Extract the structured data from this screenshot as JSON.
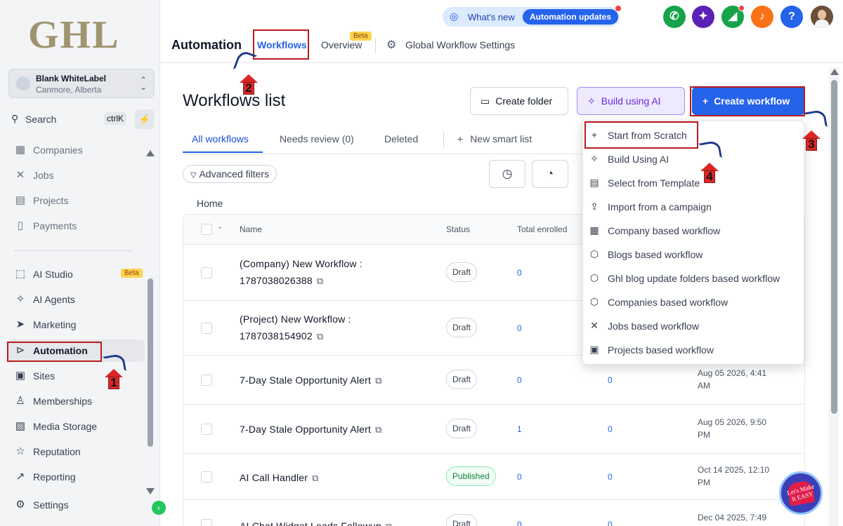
{
  "brand": {
    "logo_text": "GHL"
  },
  "account": {
    "name": "Blank WhiteLabel",
    "location": "Canmore, Alberta"
  },
  "sidebar": {
    "search_label": "Search",
    "search_shortcut": "ctrlK",
    "items": [
      {
        "label": "Companies",
        "icon": "building-icon"
      },
      {
        "label": "Jobs",
        "icon": "tools-icon"
      },
      {
        "label": "Projects",
        "icon": "folder-icon"
      },
      {
        "label": "Payments",
        "icon": "receipt-icon"
      },
      {
        "label": "AI Studio",
        "icon": "ai-studio-icon",
        "badge": "Beta"
      },
      {
        "label": "AI Agents",
        "icon": "sparkle-icon"
      },
      {
        "label": "Marketing",
        "icon": "send-icon"
      },
      {
        "label": "Automation",
        "icon": "automation-icon",
        "active": true
      },
      {
        "label": "Sites",
        "icon": "sites-icon"
      },
      {
        "label": "Memberships",
        "icon": "membership-icon"
      },
      {
        "label": "Media Storage",
        "icon": "image-icon"
      },
      {
        "label": "Reputation",
        "icon": "star-icon"
      },
      {
        "label": "Reporting",
        "icon": "chart-icon"
      },
      {
        "label": "Settings",
        "icon": "gear-icon"
      }
    ]
  },
  "header": {
    "whats_new": "What's new",
    "automation_updates": "Automation updates",
    "page_title": "Automation",
    "tabs": [
      {
        "label": "Workflows",
        "active": true
      },
      {
        "label": "Overview",
        "badge": "Beta"
      },
      {
        "label": "Global Workflow Settings"
      }
    ],
    "icon_colors": {
      "phone": "#16a34a",
      "ai": "#5b21b6",
      "megaphone": "#16a34a",
      "bell": "#f97316",
      "help": "#2563eb"
    }
  },
  "main": {
    "title": "Workflows list",
    "create_folder": "Create folder",
    "build_ai": "Build using AI",
    "create_workflow": "Create workflow",
    "subtabs": [
      "All workflows",
      "Needs review (0)",
      "Deleted"
    ],
    "new_smart_list": "New smart list",
    "advanced_filters": "Advanced filters",
    "breadcrumb": "Home"
  },
  "table": {
    "columns": [
      "Name",
      "Status",
      "Total enrolled"
    ],
    "rows": [
      {
        "name_line1": "(Company) New Workflow :",
        "name_line2": "1787038026388",
        "status": "Draft",
        "enrolled": "0",
        "active": "",
        "date_line1": "",
        "date_line2": ""
      },
      {
        "name_line1": "(Project) New Workflow :",
        "name_line2": "1787038154902",
        "status": "Draft",
        "enrolled": "0",
        "active": "",
        "date_line1": "",
        "date_line2": ""
      },
      {
        "name_line1": "7-Day Stale Opportunity Alert",
        "name_line2": "",
        "status": "Draft",
        "enrolled": "0",
        "active": "0",
        "date_line1": "Aug 05 2026, 4:41",
        "date_line2": "AM"
      },
      {
        "name_line1": "7-Day Stale Opportunity Alert",
        "name_line2": "",
        "status": "Draft",
        "enrolled": "1",
        "active": "0",
        "date_line1": "Aug 05 2026, 9:50",
        "date_line2": "PM"
      },
      {
        "name_line1": "AI Call Handler",
        "name_line2": "",
        "status": "Published",
        "enrolled": "0",
        "active": "0",
        "date_line1": "Oct 14 2025, 12:10",
        "date_line2": "PM"
      },
      {
        "name_line1": "AI Chat Widget Leads Followup",
        "name_line2": "",
        "status": "Draft",
        "enrolled": "0",
        "active": "0",
        "date_line1": "Dec 04 2025, 7:49",
        "date_line2": ""
      }
    ]
  },
  "dropdown": {
    "items": [
      {
        "label": "Start from Scratch",
        "icon": "plus-icon"
      },
      {
        "label": "Build Using AI",
        "icon": "sparkle-icon"
      },
      {
        "label": "Select from Template",
        "icon": "template-icon"
      },
      {
        "label": "Import from a campaign",
        "icon": "upload-icon"
      },
      {
        "label": "Company based workflow",
        "icon": "building-icon"
      },
      {
        "label": "Blogs based workflow",
        "icon": "cube-icon"
      },
      {
        "label": "Ghl blog update folders based workflow",
        "icon": "cube-icon"
      },
      {
        "label": "Companies based workflow",
        "icon": "cube-icon"
      },
      {
        "label": "Jobs based workflow",
        "icon": "tools-icon"
      },
      {
        "label": "Projects based workflow",
        "icon": "clipboard-icon"
      }
    ]
  },
  "annotations": {
    "steps": [
      "1",
      "2",
      "3",
      "4"
    ],
    "watermark": "Let's Make It EASY"
  }
}
